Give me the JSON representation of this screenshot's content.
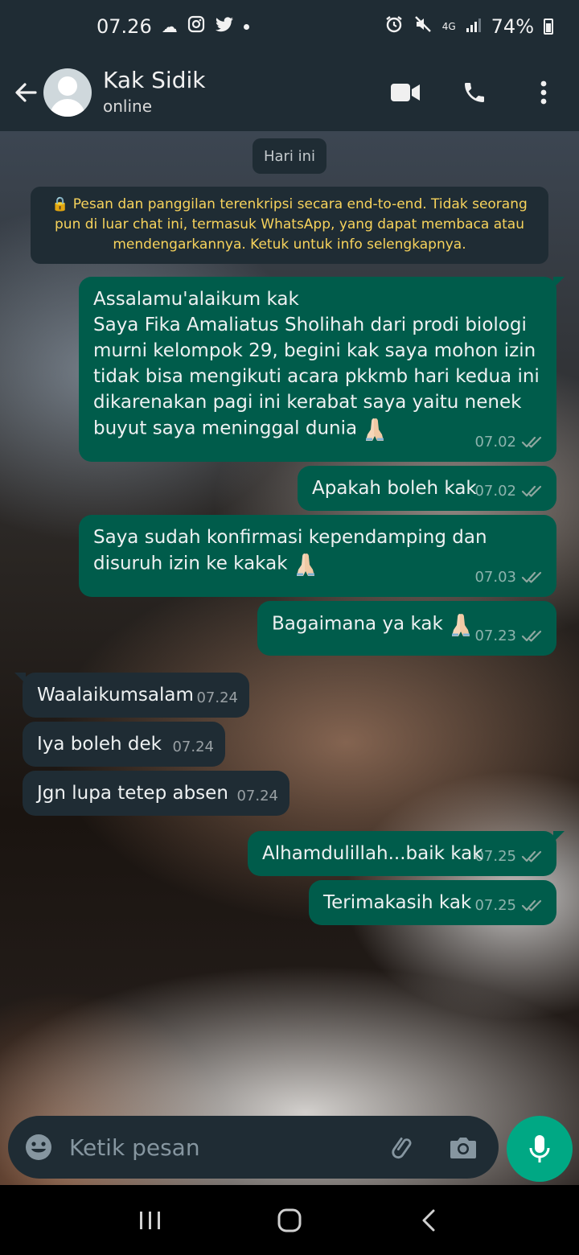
{
  "status_bar": {
    "time": "07.26",
    "network": "4G",
    "battery": "74%"
  },
  "header": {
    "contact_name": "Kak Sidik",
    "contact_status": "online"
  },
  "chat": {
    "date_label": "Hari ini",
    "encryption_notice": "🔒 Pesan dan panggilan terenkripsi secara end-to-end. Tidak seorang pun di luar chat ini, termasuk WhatsApp, yang dapat membaca atau mendengarkannya. Ketuk untuk info selengkapnya.",
    "messages": [
      {
        "direction": "out",
        "text": "Assalamu'alaikum kak\nSaya Fika Amaliatus Sholihah dari prodi biologi murni kelompok 29, begini kak saya mohon izin tidak bisa mengikuti acara pkkmb hari kedua ini dikarenakan pagi ini kerabat saya yaitu nenek buyut saya meninggal dunia",
        "emoji": "folded-hands",
        "time": "07.02",
        "status": "read"
      },
      {
        "direction": "out",
        "text": "Apakah boleh kak",
        "time": "07.02",
        "status": "read"
      },
      {
        "direction": "out",
        "text": "Saya sudah konfirmasi kependamping dan disuruh izin ke kakak",
        "emoji": "folded-hands",
        "time": "07.03",
        "status": "read"
      },
      {
        "direction": "out",
        "text": "Bagaimana ya kak",
        "emoji": "folded-hands",
        "time": "07.23",
        "status": "read"
      },
      {
        "direction": "in",
        "text": "Waalaikumsalam",
        "time": "07.24"
      },
      {
        "direction": "in",
        "text": "Iya boleh dek",
        "time": "07.24"
      },
      {
        "direction": "in",
        "text": "Jgn lupa tetep absen",
        "time": "07.24"
      },
      {
        "direction": "out",
        "text": "Alhamdulillah...baik kak",
        "time": "07.25",
        "status": "read"
      },
      {
        "direction": "out",
        "text": "Terimakasih kak",
        "time": "07.25",
        "status": "read"
      }
    ]
  },
  "composer": {
    "placeholder": "Ketik pesan"
  },
  "colors": {
    "header_bg": "#1f2c34",
    "outgoing_bubble": "#005c4b",
    "incoming_bubble": "#1f2c34",
    "accent": "#00a884",
    "notice_text": "#f7d35c",
    "read_ticks": "#8fa7a0"
  },
  "icons": [
    "back-arrow-icon",
    "video-call-icon",
    "phone-icon",
    "more-options-icon",
    "emoji-icon",
    "attach-icon",
    "camera-icon",
    "mic-icon",
    "recents-icon",
    "home-icon",
    "nav-back-icon"
  ]
}
